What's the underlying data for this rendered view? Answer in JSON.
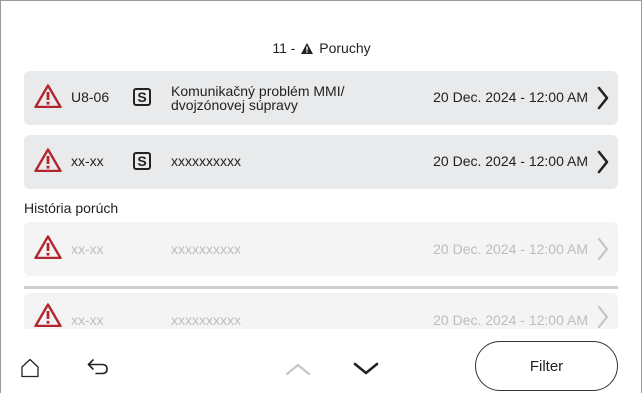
{
  "header": {
    "count": "11",
    "separator": " - ",
    "title": "Poruchy"
  },
  "active_faults": [
    {
      "code": "U8-06",
      "badge": "S",
      "description_line1": "Komunikačný problém MMI/",
      "description_line2": "dvojzónovej súpravy",
      "date": "20 Dec. 2024 - 12:00 AM"
    },
    {
      "code": "xx-xx",
      "badge": "S",
      "description_line1": "xxxxxxxxxx",
      "description_line2": "",
      "date": "20 Dec. 2024 - 12:00 AM"
    }
  ],
  "history": {
    "label": "História porúch",
    "items": [
      {
        "code": "xx-xx",
        "description": "xxxxxxxxxx",
        "date": "20 Dec. 2024 - 12:00 AM"
      },
      {
        "code": "xx-xx",
        "description": "xxxxxxxxxx",
        "date": "20 Dec. 2024 - 12:00 AM"
      }
    ]
  },
  "bottom_bar": {
    "filter_label": "Filter",
    "icons": [
      "home-icon",
      "back-icon",
      "chevron-up-icon",
      "chevron-down-icon"
    ]
  },
  "colors": {
    "alert_red": "#b3262e",
    "row_bg": "#e9eaeb",
    "faded_text": "#bdbdbd"
  }
}
